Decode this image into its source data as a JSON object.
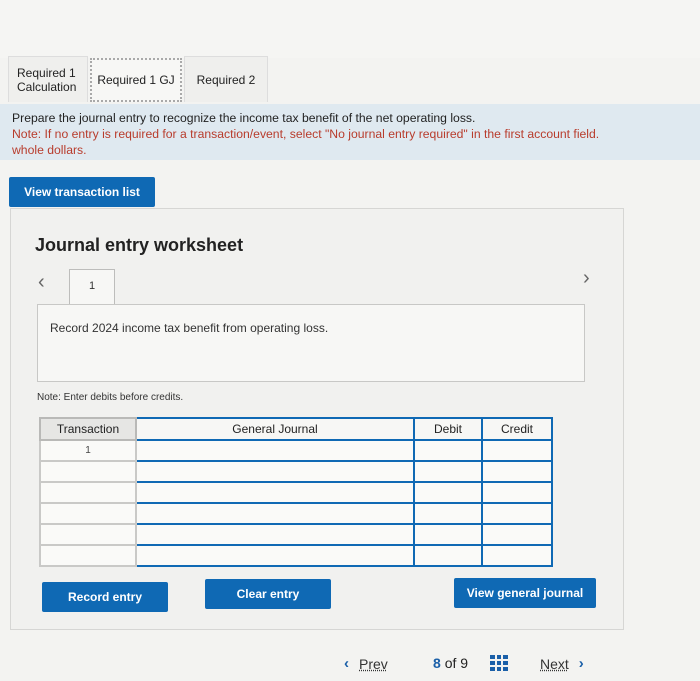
{
  "tabs": [
    {
      "label_line1": "Required 1",
      "label_line2": "Calculation"
    },
    {
      "label": "Required 1 GJ"
    },
    {
      "label": "Required 2"
    }
  ],
  "instructions": {
    "line1": "Prepare the journal entry to recognize the income tax benefit of the net operating loss.",
    "line2": "Note: If no entry is required for a transaction/event, select \"No journal entry required\" in the first account field.",
    "line3": "whole dollars."
  },
  "buttons": {
    "view_transaction_list": "View transaction list",
    "record_entry": "Record entry",
    "clear_entry": "Clear entry",
    "view_general_journal": "View general journal"
  },
  "worksheet": {
    "title": "Journal entry worksheet",
    "entry_number": "1",
    "description": "Record 2024 income tax benefit from operating loss.",
    "note": "Note: Enter debits before credits."
  },
  "table": {
    "headers": [
      "Transaction",
      "General Journal",
      "Debit",
      "Credit"
    ],
    "rows": [
      {
        "transaction": "1",
        "account": "",
        "debit": "",
        "credit": ""
      },
      {
        "transaction": "",
        "account": "",
        "debit": "",
        "credit": ""
      },
      {
        "transaction": "",
        "account": "",
        "debit": "",
        "credit": ""
      },
      {
        "transaction": "",
        "account": "",
        "debit": "",
        "credit": ""
      },
      {
        "transaction": "",
        "account": "",
        "debit": "",
        "credit": ""
      },
      {
        "transaction": "",
        "account": "",
        "debit": "",
        "credit": ""
      }
    ]
  },
  "pager": {
    "prev_label": "Prev",
    "current": "8",
    "of_text": "of 9",
    "next_label": "Next"
  },
  "icons": {
    "prev": "chevron-left-icon",
    "next": "chevron-right-icon",
    "grid": "grid-icon"
  }
}
